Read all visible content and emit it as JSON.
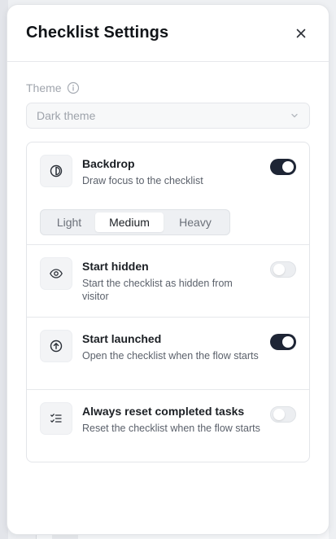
{
  "panel": {
    "title": "Checklist Settings",
    "close_icon": "close-icon"
  },
  "theme": {
    "label": "Theme",
    "info_icon": "info-icon",
    "selected": "Dark theme",
    "disabled": true
  },
  "settings": {
    "backdrop": {
      "title": "Backdrop",
      "description": "Draw focus to the checklist",
      "icon": "contrast-icon",
      "enabled": true,
      "intensity": {
        "options": [
          "Light",
          "Medium",
          "Heavy"
        ],
        "selected": "Medium"
      }
    },
    "start_hidden": {
      "title": "Start hidden",
      "description": "Start the checklist as hidden from visitor",
      "icon": "eye-icon",
      "enabled": false
    },
    "start_launched": {
      "title": "Start launched",
      "description": "Open the checklist when the flow starts",
      "icon": "arrow-up-circle-icon",
      "enabled": true
    },
    "reset_tasks": {
      "title": "Always reset completed tasks",
      "description": "Reset the checklist when the flow starts",
      "icon": "list-checks-icon",
      "enabled": false
    }
  },
  "colors": {
    "toggle_on": "#1e2535",
    "toggle_off": "#eceef1",
    "border": "#e3e5e9"
  }
}
